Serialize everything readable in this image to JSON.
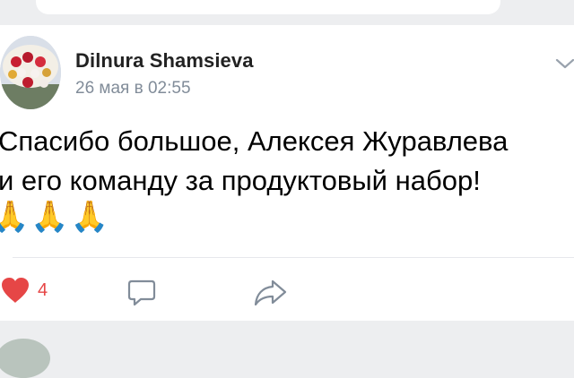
{
  "post": {
    "author": "Dilnura Shamsieva",
    "timestamp": "26 мая в 02:55",
    "text": "Спасибо большое, Алексея Журавлева\nи его команду за продуктовый набор!",
    "emojis": "🙏🙏🙏",
    "likes": "4"
  },
  "icons": {
    "like": "heart-icon",
    "comment": "comment-icon",
    "share": "share-icon",
    "more": "more-icon"
  },
  "colors": {
    "like": "#e64646",
    "icon": "#818c99",
    "author": "#222222",
    "timestamp": "#818c99"
  }
}
